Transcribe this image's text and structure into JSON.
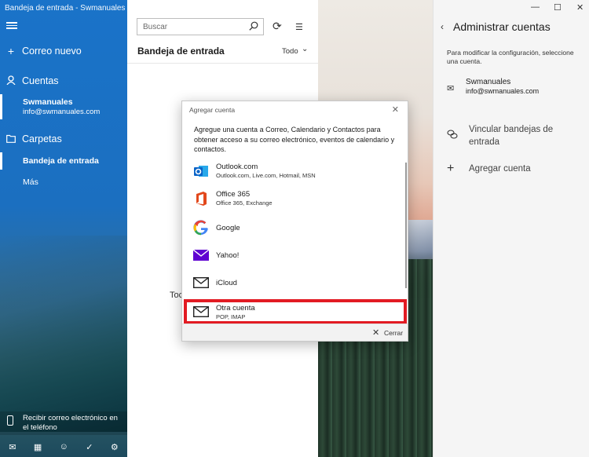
{
  "window": {
    "title": "Bandeja de entrada - Swmanuales"
  },
  "nav": {
    "new_mail": "Correo nuevo",
    "accounts": "Cuentas",
    "account": {
      "name": "Swmanuales",
      "email": "info@swmanuales.com"
    },
    "folders": "Carpetas",
    "inbox": "Bandeja de entrada",
    "more": "Más",
    "phone_promo": "Recibir correo electrónico en el teléfono",
    "bottom_icons": [
      "mail-icon",
      "calendar-icon",
      "people-icon",
      "todo-icon",
      "settings-icon"
    ]
  },
  "middle": {
    "search_placeholder": "Buscar",
    "title": "Bandeja de entrada",
    "filter": "Todo",
    "partial_text": "Toc"
  },
  "right": {
    "title": "Administrar cuentas",
    "description": "Para modificar la configuración, seleccione una cuenta.",
    "account": {
      "name": "Swmanuales",
      "email": "info@swmanuales.com"
    },
    "link_inboxes": "Vincular bandejas de entrada",
    "add_account": "Agregar cuenta"
  },
  "dialog": {
    "title": "Agregar cuenta",
    "intro": "Agregue una cuenta a Correo, Calendario y Contactos para obtener acceso a su correo electrónico, eventos de calendario y contactos.",
    "providers": [
      {
        "name": "Outlook.com",
        "sub": "Outlook.com, Live.com, Hotmail, MSN",
        "icon": "outlook-icon",
        "color": "#0a64c8"
      },
      {
        "name": "Office 365",
        "sub": "Office 365, Exchange",
        "icon": "office-icon",
        "color": "#e2481c"
      },
      {
        "name": "Google",
        "sub": "",
        "icon": "google-icon",
        "color": "#4285f4"
      },
      {
        "name": "Yahoo!",
        "sub": "",
        "icon": "yahoo-icon",
        "color": "#5f01d1"
      },
      {
        "name": "iCloud",
        "sub": "",
        "icon": "envelope-icon",
        "color": "#222222"
      },
      {
        "name": "Otra cuenta",
        "sub": "POP, IMAP",
        "icon": "envelope-icon",
        "color": "#222222"
      }
    ],
    "close": "Cerrar",
    "highlight_color": "#e21b23"
  }
}
